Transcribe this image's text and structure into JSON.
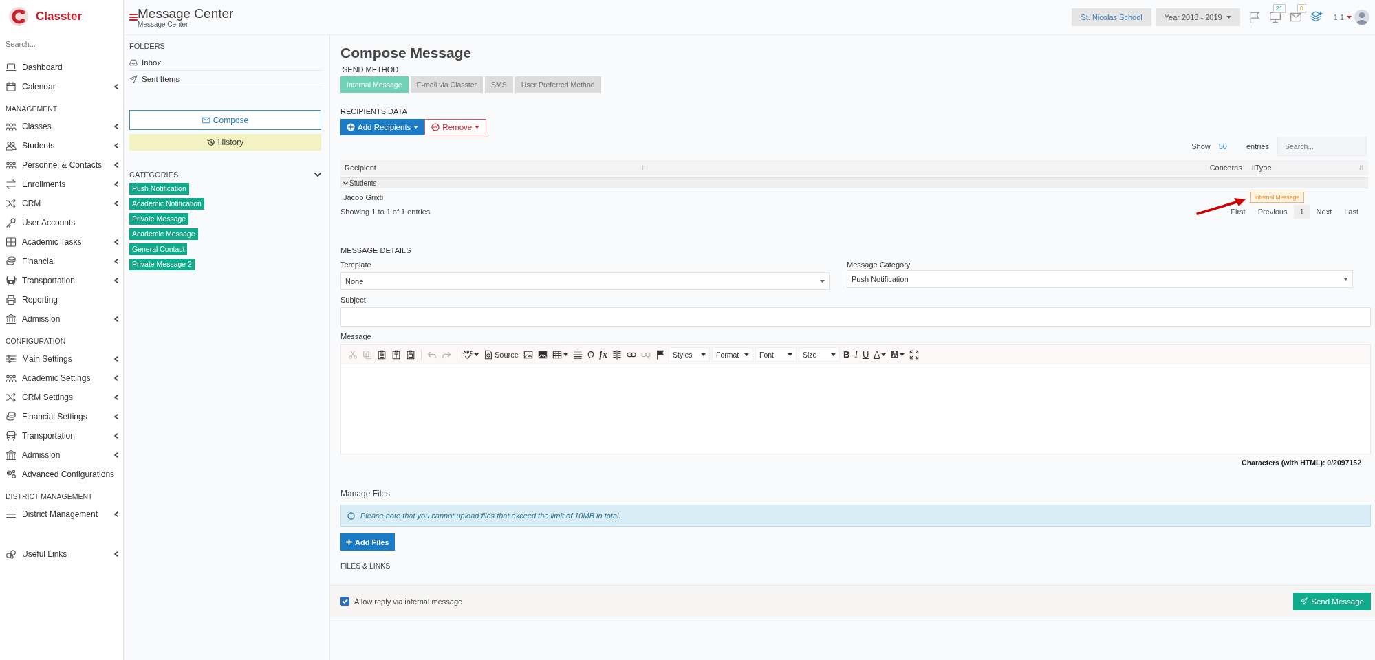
{
  "brand": {
    "name": "Classter"
  },
  "sidebar": {
    "search_placeholder": "Search...",
    "sections": [
      {
        "items": [
          {
            "label": "Dashboard",
            "expandable": false
          },
          {
            "label": "Calendar",
            "expandable": true
          }
        ]
      },
      {
        "heading": "MANAGEMENT",
        "items": [
          {
            "label": "Classes",
            "expandable": true
          },
          {
            "label": "Students",
            "expandable": true
          },
          {
            "label": "Personnel & Contacts",
            "expandable": true
          },
          {
            "label": "Enrollments",
            "expandable": true
          },
          {
            "label": "CRM",
            "expandable": true
          },
          {
            "label": "User Accounts",
            "expandable": false
          },
          {
            "label": "Academic Tasks",
            "expandable": true
          },
          {
            "label": "Financial",
            "expandable": true
          },
          {
            "label": "Transportation",
            "expandable": true
          },
          {
            "label": "Reporting",
            "expandable": false
          },
          {
            "label": "Admission",
            "expandable": true
          }
        ]
      },
      {
        "heading": "CONFIGURATION",
        "items": [
          {
            "label": "Main Settings",
            "expandable": true
          },
          {
            "label": "Academic Settings",
            "expandable": true
          },
          {
            "label": "CRM Settings",
            "expandable": true
          },
          {
            "label": "Financial Settings",
            "expandable": true
          },
          {
            "label": "Transportation",
            "expandable": true
          },
          {
            "label": "Admission",
            "expandable": true
          },
          {
            "label": "Advanced Configurations",
            "expandable": false
          }
        ]
      },
      {
        "heading": "DISTRICT MANAGEMENT",
        "items": [
          {
            "label": "District Management",
            "expandable": true
          }
        ]
      }
    ],
    "footer_item": {
      "label": "Useful Links",
      "expandable": true
    }
  },
  "header": {
    "title": "Message Center",
    "subtitle": "Message Center",
    "school": "St. Nicolas School",
    "year": "Year 2018 - 2019",
    "notifications_count": "21",
    "messages_count": "0",
    "user": "1 1"
  },
  "folders": {
    "heading": "FOLDERS",
    "items": [
      {
        "label": "Inbox"
      },
      {
        "label": "Sent Items"
      }
    ],
    "compose_button": "Compose",
    "history_button": "History"
  },
  "categories": {
    "heading": "CATEGORIES",
    "expanded": true,
    "items": [
      "Push Notification",
      "Academic Notification",
      "Private Message",
      "Academic Message",
      "General Contact",
      "Private Message 2"
    ]
  },
  "compose": {
    "title": "Compose Message",
    "send_method_label": "SEND METHOD",
    "methods": [
      {
        "label": "Internal Message",
        "selected": true
      },
      {
        "label": "E-mail via Classter",
        "selected": false
      },
      {
        "label": "SMS",
        "selected": false
      },
      {
        "label": "User Preferred Method",
        "selected": false
      }
    ],
    "recipients_heading": "RECIPIENTS DATA",
    "add_button": "Add Recipients",
    "remove_button": "Remove",
    "table": {
      "show_label": "Show",
      "page_size": "50",
      "entries_label": "entries",
      "search_placeholder": "Search...",
      "columns": [
        "Recipient",
        "Concerns",
        "Type"
      ],
      "group": "Students",
      "rows": [
        {
          "recipient": "Jacob Grixti",
          "type": "Internal Message"
        }
      ],
      "info": "Showing 1 to 1 of 1 entries",
      "pagination": [
        {
          "label": "First",
          "selected": false
        },
        {
          "label": "Previous",
          "selected": false
        },
        {
          "label": "1",
          "selected": true
        },
        {
          "label": "Next",
          "selected": false
        },
        {
          "label": "Last",
          "selected": false
        }
      ]
    }
  },
  "details": {
    "heading": "MESSAGE DETAILS",
    "template_label": "Template",
    "template_value": "None",
    "category_label": "Message Category",
    "category_value": "Push Notification",
    "subject_label": "Subject",
    "message_label": "Message",
    "toolbar": [
      {
        "kind": "icon",
        "disabled": true,
        "dropdown": false
      },
      {
        "kind": "icon",
        "disabled": true,
        "dropdown": false
      },
      {
        "kind": "icon",
        "disabled": false,
        "dropdown": false
      },
      {
        "kind": "icon",
        "disabled": false,
        "dropdown": false
      },
      {
        "kind": "icon",
        "disabled": false,
        "dropdown": false
      },
      {
        "kind": "separator"
      },
      {
        "kind": "icon",
        "disabled": true,
        "dropdown": false
      },
      {
        "kind": "icon",
        "disabled": true,
        "dropdown": false
      },
      {
        "kind": "separator"
      },
      {
        "kind": "icon",
        "disabled": false,
        "dropdown": true
      },
      {
        "kind": "icon-label",
        "label": "Source",
        "disabled": false,
        "dropdown": false
      },
      {
        "kind": "icon",
        "disabled": false,
        "dropdown": false
      },
      {
        "kind": "icon",
        "disabled": false,
        "dropdown": false
      },
      {
        "kind": "icon",
        "disabled": false,
        "dropdown": true
      },
      {
        "kind": "icon",
        "disabled": false,
        "dropdown": false
      },
      {
        "kind": "symbol",
        "text": "Ω",
        "disabled": false,
        "dropdown": false
      },
      {
        "kind": "formula",
        "text": "fx",
        "disabled": false,
        "dropdown": false
      },
      {
        "kind": "icon",
        "disabled": false,
        "dropdown": false
      },
      {
        "kind": "icon",
        "disabled": false,
        "dropdown": false
      },
      {
        "kind": "icon",
        "disabled": true,
        "dropdown": false
      },
      {
        "kind": "icon",
        "disabled": false,
        "dropdown": false
      },
      {
        "kind": "combo",
        "label": "Styles"
      },
      {
        "kind": "combo",
        "label": "Format"
      },
      {
        "kind": "combo",
        "label": "Font"
      },
      {
        "kind": "combo",
        "label": "Size"
      },
      {
        "kind": "bold",
        "text": "B",
        "disabled": false,
        "dropdown": false
      },
      {
        "kind": "italic",
        "text": "I",
        "disabled": false,
        "dropdown": false
      },
      {
        "kind": "underline",
        "text": "U",
        "disabled": false,
        "dropdown": false
      },
      {
        "kind": "color",
        "text": "A",
        "disabled": false,
        "dropdown": true
      },
      {
        "kind": "background",
        "text": "A",
        "disabled": false,
        "dropdown": true
      },
      {
        "kind": "icon",
        "disabled": false,
        "dropdown": false
      }
    ],
    "char_count": "Characters (with HTML): 0/2097152"
  },
  "files": {
    "title": "Manage Files",
    "note": "Please note that you cannot upload files that exceed the limit of 10MB in total.",
    "add_button": "Add Files",
    "links_heading": "FILES & LINKS"
  },
  "footer": {
    "allow_reply": true,
    "allow_reply_label": "Allow reply via internal message",
    "send_button": "Send Message"
  }
}
